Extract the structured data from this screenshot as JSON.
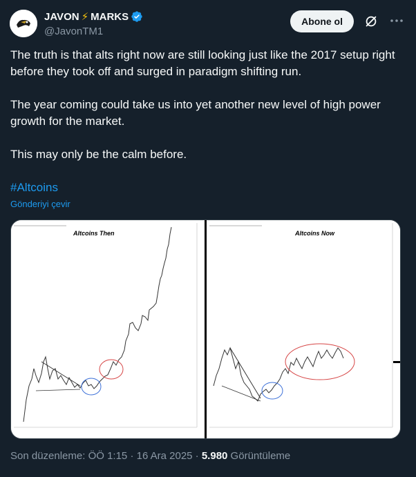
{
  "author": {
    "name_part1": "JAVON",
    "name_emoji": "⚡",
    "name_part2": "MARKS",
    "handle": "@JavonTM1",
    "verified": true,
    "verified_color": "#1d9bf0"
  },
  "actions": {
    "follow_label": "Abone ol",
    "grok_icon": "grok-icon",
    "more_icon": "more-icon"
  },
  "post": {
    "paragraphs": [
      "The truth is that alts right now are still looking just like the 2017 setup right before they took off and surged in paradigm shifting run.",
      "The year coming could take us into yet another new level of high power growth for the market.",
      "This may only be the calm before."
    ],
    "hashtag": "#Altcoins",
    "translate_label": "Gönderiyi çevir"
  },
  "media": {
    "left_title": "Altcoins Then",
    "right_title": "Altcoins Now"
  },
  "footer": {
    "edited_label": "Son düzenleme: ÖÖ 1:15 · 16 Ara 2025 · ",
    "views_count": "5.980",
    "views_label": " Görüntüleme"
  },
  "colors": {
    "background": "#15202b",
    "accent": "#1d9bf0",
    "muted": "#8b98a5"
  }
}
